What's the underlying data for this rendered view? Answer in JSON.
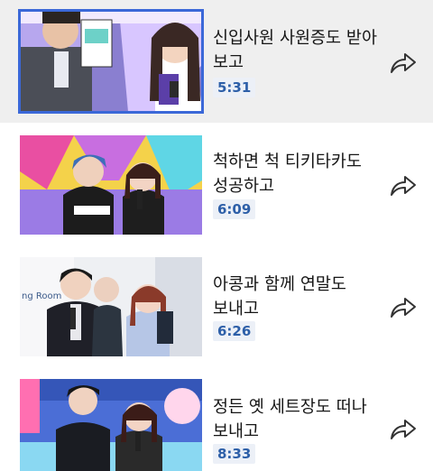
{
  "videos": [
    {
      "title": "신입사원 사원증도 받아 보고",
      "duration": "5:31",
      "active": true
    },
    {
      "title": "척하면 척 티키타카도 성공하고",
      "duration": "6:09",
      "active": false
    },
    {
      "title": "아콩과 함께 연말도 보내고",
      "duration": "6:26",
      "active": false
    },
    {
      "title": "정든 옛 세트장도 떠나 보내고",
      "duration": "8:33",
      "active": false
    }
  ],
  "thumbnail_text": {
    "room_sign": "ng Room"
  },
  "icons": {
    "share": "share-arrow-icon"
  },
  "colors": {
    "highlight": "#efefef",
    "selected_border": "#3b68d8",
    "duration_bg": "#ecf0f7",
    "duration_text": "#2d5fa8"
  }
}
